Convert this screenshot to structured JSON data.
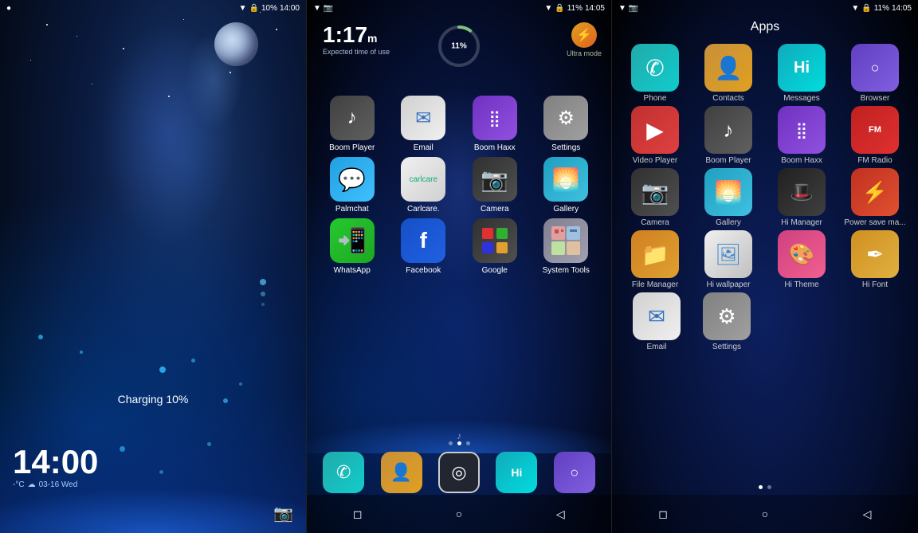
{
  "panels": {
    "lockscreen": {
      "status": {
        "left_icon": "●",
        "battery": "10%",
        "time": "14:00"
      },
      "charging": "Charging 10%",
      "time_big": "14:00",
      "time_deg": "-°C",
      "date": "03-16 Wed"
    },
    "homescreen": {
      "status": {
        "battery": "11%",
        "time": "14:05"
      },
      "time_widget": "1:17",
      "time_sub": "m",
      "expected_label": "Expected time of use",
      "ultra_label": "Ultra mode",
      "battery_pct": "11%",
      "apps": [
        {
          "label": "Boom Player",
          "icon_class": "icon-boom",
          "icon": "♪"
        },
        {
          "label": "Email",
          "icon_class": "icon-email",
          "icon": "✉"
        },
        {
          "label": "Boom Haxx",
          "icon_class": "icon-boomhaxx",
          "icon": "⠿"
        },
        {
          "label": "Settings",
          "icon_class": "icon-settings",
          "icon": "⚙"
        },
        {
          "label": "Palmchat",
          "icon_class": "icon-palmchat",
          "icon": "💬"
        },
        {
          "label": "Carlcare.",
          "icon_class": "icon-carlcare",
          "icon": ""
        },
        {
          "label": "Camera",
          "icon_class": "icon-camera",
          "icon": "📷"
        },
        {
          "label": "Gallery",
          "icon_class": "icon-gallery",
          "icon": "🌅"
        },
        {
          "label": "WhatsApp",
          "icon_class": "icon-whatsapp",
          "icon": "✆"
        },
        {
          "label": "Facebook",
          "icon_class": "icon-facebook",
          "icon": "f"
        },
        {
          "label": "Google",
          "icon_class": "icon-google",
          "icon": "G"
        },
        {
          "label": "System Tools",
          "icon_class": "icon-systemtools",
          "icon": "⊞"
        }
      ],
      "dock": [
        {
          "label": "Phone",
          "icon_class": "icon-dock-phone",
          "icon": "✆"
        },
        {
          "label": "Contacts",
          "icon_class": "icon-dock-contacts",
          "icon": "👤"
        },
        {
          "label": "Target",
          "icon_class": "icon-dock-target",
          "icon": "◎"
        },
        {
          "label": "Hi",
          "icon_class": "icon-dock-hi",
          "icon": "Hi"
        },
        {
          "label": "Browser",
          "icon_class": "icon-dock-browser",
          "icon": "○"
        }
      ]
    },
    "appdrawer": {
      "title": "Apps",
      "status": {
        "battery": "11%",
        "time": "14:05"
      },
      "apps": [
        {
          "label": "Phone",
          "icon_class": "icon-phone",
          "icon": "✆"
        },
        {
          "label": "Contacts",
          "icon_class": "icon-contacts",
          "icon": "👤"
        },
        {
          "label": "Messages",
          "icon_class": "icon-messages",
          "icon": "Hi"
        },
        {
          "label": "Browser",
          "icon_class": "icon-browser",
          "icon": "○"
        },
        {
          "label": "Video Player",
          "icon_class": "icon-video",
          "icon": "▶"
        },
        {
          "label": "Boom Player",
          "icon_class": "icon-boom",
          "icon": "♪"
        },
        {
          "label": "Boom Haxx",
          "icon_class": "icon-boomhaxx",
          "icon": "⠿"
        },
        {
          "label": "FM Radio",
          "icon_class": "icon-fmradio",
          "icon": "FM"
        },
        {
          "label": "Camera",
          "icon_class": "icon-camera",
          "icon": "📷"
        },
        {
          "label": "Gallery",
          "icon_class": "icon-gallery",
          "icon": "🌅"
        },
        {
          "label": "Hi Manager",
          "icon_class": "icon-himanager",
          "icon": "🎩"
        },
        {
          "label": "Power save ma...",
          "icon_class": "icon-powersave",
          "icon": "⚡"
        },
        {
          "label": "File Manager",
          "icon_class": "icon-filemanager",
          "icon": "📁"
        },
        {
          "label": "Hi wallpaper",
          "icon_class": "icon-hiwallpaper",
          "icon": "🖼"
        },
        {
          "label": "Hi Theme",
          "icon_class": "icon-hitheme",
          "icon": "🎨"
        },
        {
          "label": "Hi Font",
          "icon_class": "icon-hifont",
          "icon": "✒"
        },
        {
          "label": "Email",
          "icon_class": "icon-email",
          "icon": "✉"
        },
        {
          "label": "Settings",
          "icon_class": "icon-settings",
          "icon": "⚙"
        }
      ]
    }
  }
}
